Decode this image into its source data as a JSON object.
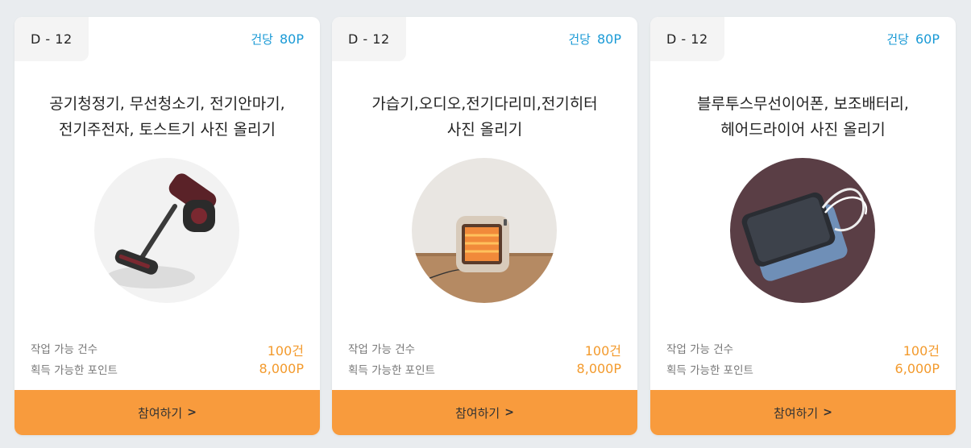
{
  "cards": [
    {
      "dday": "D - 12",
      "per_item_label": "건당",
      "per_item_points": "80P",
      "title_line1": "공기청정기, 무선청소기, 전기안마기,",
      "title_line2": "전기주전자, 토스트기 사진 올리기",
      "image": "cordless-vacuum-image",
      "available_label": "작업 가능 건수",
      "available_value": "100건",
      "points_label": "획득 가능한 포인트",
      "points_value": "8,000P",
      "button_label": "참여하기"
    },
    {
      "dday": "D - 12",
      "per_item_label": "건당",
      "per_item_points": "80P",
      "title_line1": "가습기,오디오,전기다리미,전기히터",
      "title_line2": "사진 올리기",
      "image": "electric-heater-image",
      "available_label": "작업 가능 건수",
      "available_value": "100건",
      "points_label": "획득 가능한 포인트",
      "points_value": "8,000P",
      "button_label": "참여하기"
    },
    {
      "dday": "D - 12",
      "per_item_label": "건당",
      "per_item_points": "60P",
      "title_line1": "블루투스무선이어폰, 보조배터리,",
      "title_line2": "헤어드라이어 사진 올리기",
      "image": "power-bank-image",
      "available_label": "작업 가능 건수",
      "available_value": "100건",
      "points_label": "획득 가능한 포인트",
      "points_value": "6,000P",
      "button_label": "참여하기"
    }
  ],
  "colors": {
    "accent_blue": "#1a9ad6",
    "accent_orange": "#f39a2c",
    "button_orange": "#f89b3d",
    "background": "#e9ecef"
  },
  "icons": {
    "button_chevron": "chevron-right-icon"
  }
}
